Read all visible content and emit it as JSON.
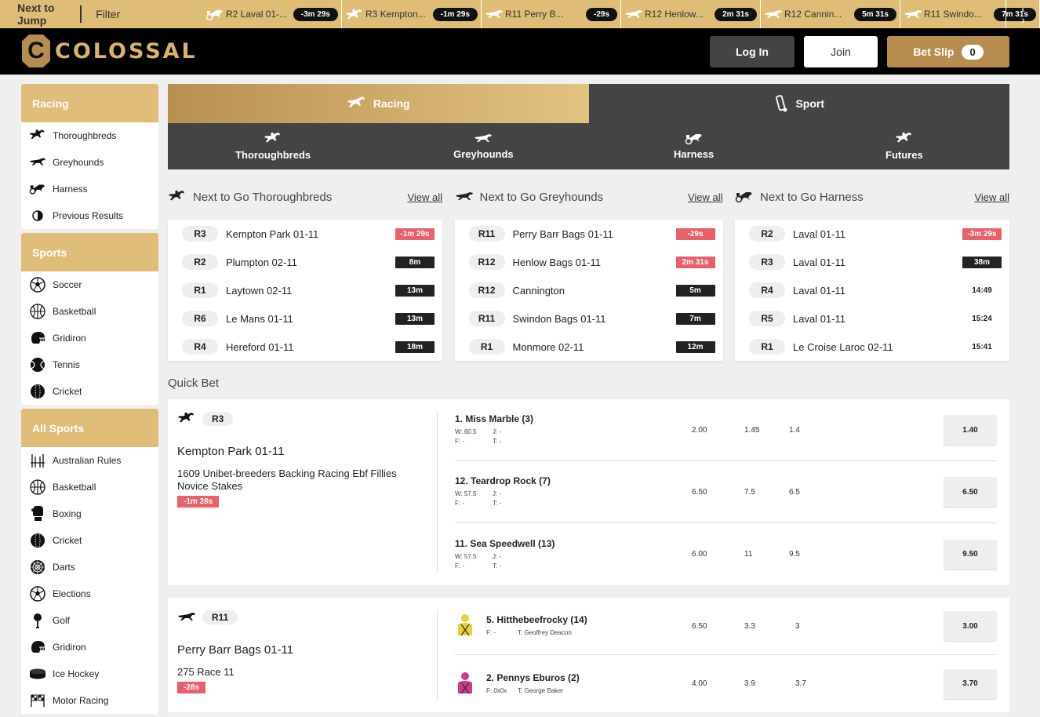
{
  "topbar": {
    "next_to_jump": "Next to Jump",
    "filter": "Filter",
    "items": [
      {
        "name": "R2 Laval 01-...",
        "time": "-3m 29s",
        "icon": "harness-icon"
      },
      {
        "name": "R3 Kempton...",
        "time": "-1m 29s",
        "icon": "horse-icon"
      },
      {
        "name": "R11 Perry B...",
        "time": "-29s",
        "icon": "greyhound-icon"
      },
      {
        "name": "R12 Henlow...",
        "time": "2m 31s",
        "icon": "greyhound-icon"
      },
      {
        "name": "R12 Cannin...",
        "time": "5m 31s",
        "icon": "greyhound-icon"
      },
      {
        "name": "R11 Swindo...",
        "time": "7m 31s",
        "icon": "greyhound-icon"
      }
    ]
  },
  "header": {
    "logo_letter": "C",
    "logo_text": "COLOSSAL",
    "login": "Log In",
    "join": "Join",
    "betslip": "Bet Slip",
    "betslip_count": "0"
  },
  "sidebar": {
    "racing": {
      "title": "Racing",
      "items": [
        {
          "label": "Thoroughbreds",
          "icon": "horse-icon"
        },
        {
          "label": "Greyhounds",
          "icon": "greyhound-icon"
        },
        {
          "label": "Harness",
          "icon": "harness-icon"
        },
        {
          "label": "Previous Results",
          "icon": "results-icon"
        }
      ]
    },
    "sports": {
      "title": "Sports",
      "items": [
        {
          "label": "Soccer",
          "icon": "soccer-ball-icon"
        },
        {
          "label": "Basketball",
          "icon": "basketball-icon"
        },
        {
          "label": "Gridiron",
          "icon": "helmet-icon"
        },
        {
          "label": "Tennis",
          "icon": "tennis-ball-icon"
        },
        {
          "label": "Cricket",
          "icon": "cricket-ball-icon"
        }
      ]
    },
    "all_sports": {
      "title": "All Sports",
      "items": [
        {
          "label": "Australian Rules",
          "icon": "goalposts-icon"
        },
        {
          "label": "Basketball",
          "icon": "basketball-icon"
        },
        {
          "label": "Boxing",
          "icon": "boxing-glove-icon"
        },
        {
          "label": "Cricket",
          "icon": "cricket-ball-icon"
        },
        {
          "label": "Darts",
          "icon": "dartboard-icon"
        },
        {
          "label": "Elections",
          "icon": "soccer-ball-icon"
        },
        {
          "label": "Golf",
          "icon": "golf-icon"
        },
        {
          "label": "Gridiron",
          "icon": "helmet-icon"
        },
        {
          "label": "Ice Hockey",
          "icon": "puck-icon"
        },
        {
          "label": "Motor Racing",
          "icon": "chequered-flag-icon"
        }
      ]
    }
  },
  "main_tabs": {
    "racing": "Racing",
    "sport": "Sport"
  },
  "sub_tabs": [
    "Thoroughbreds",
    "Greyhounds",
    "Harness",
    "Futures"
  ],
  "next_to_go": [
    {
      "title": "Next to Go Thoroughbreds",
      "view_all": "View all",
      "icon": "horse-icon",
      "races": [
        {
          "race": "R3",
          "name": "Kempton Park 01-11",
          "time": "-1m 29s",
          "style": "red"
        },
        {
          "race": "R2",
          "name": "Plumpton 02-11",
          "time": "8m",
          "style": "dark"
        },
        {
          "race": "R1",
          "name": "Laytown 02-11",
          "time": "13m",
          "style": "dark"
        },
        {
          "race": "R6",
          "name": "Le Mans 01-11",
          "time": "13m",
          "style": "dark"
        },
        {
          "race": "R4",
          "name": "Hereford 01-11",
          "time": "18m",
          "style": "dark"
        }
      ]
    },
    {
      "title": "Next to Go Greyhounds",
      "view_all": "View all",
      "icon": "greyhound-icon",
      "races": [
        {
          "race": "R11",
          "name": "Perry Barr Bags 01-11",
          "time": "-29s",
          "style": "red"
        },
        {
          "race": "R12",
          "name": "Henlow Bags 01-11",
          "time": "2m 31s",
          "style": "red"
        },
        {
          "race": "R12",
          "name": "Cannington",
          "time": "5m",
          "style": "dark"
        },
        {
          "race": "R11",
          "name": "Swindon Bags 01-11",
          "time": "7m",
          "style": "dark"
        },
        {
          "race": "R1",
          "name": "Monmore 02-11",
          "time": "12m",
          "style": "dark"
        }
      ]
    },
    {
      "title": "Next to Go Harness",
      "view_all": "View all",
      "icon": "harness-icon",
      "races": [
        {
          "race": "R2",
          "name": "Laval 01-11",
          "time": "-3m 29s",
          "style": "red"
        },
        {
          "race": "R3",
          "name": "Laval 01-11",
          "time": "38m",
          "style": "dark"
        },
        {
          "race": "R4",
          "name": "Laval 01-11",
          "time": "14:49",
          "style": "plain"
        },
        {
          "race": "R5",
          "name": "Laval 01-11",
          "time": "15:24",
          "style": "plain"
        },
        {
          "race": "R1",
          "name": "Le Croise Laroc 02-11",
          "time": "15:41",
          "style": "plain"
        }
      ]
    }
  ],
  "quick_bet": {
    "title": "Quick Bet",
    "cards": [
      {
        "icon": "horse-icon",
        "race": "R3",
        "venue": "Kempton Park 01-11",
        "race_name": "1609 Unibet-breeders Backing Racing Ebf Fillies Novice Stakes",
        "time": "-1m 28s",
        "runners": [
          {
            "name": "1. Miss Marble (3)",
            "w": "W: 60.5",
            "j": "J: -",
            "f": "F: -",
            "t": "T: -",
            "o1": "2.00",
            "o2": "1.45",
            "o3": "1.4",
            "price": "1.40"
          },
          {
            "name": "12. Teardrop Rock (7)",
            "w": "W: 57.5",
            "j": "J: -",
            "f": "F: -",
            "t": "T: -",
            "o1": "6.50",
            "o2": "7.5",
            "o3": "6.5",
            "price": "6.50"
          },
          {
            "name": "11. Sea Speedwell (13)",
            "w": "W: 57.5",
            "j": "J: -",
            "f": "F: -",
            "t": "T: -",
            "o1": "6.00",
            "o2": "11",
            "o3": "9.5",
            "price": "9.50"
          }
        ]
      },
      {
        "icon": "greyhound-icon",
        "race": "R11",
        "venue": "Perry Barr Bags 01-11",
        "race_name": "275 Race 11",
        "time": "-28s",
        "runners": [
          {
            "name": "5. Hitthebeefrocky (14)",
            "f": "F: -",
            "t": "T: Geoffrey Deacon",
            "o1": "6.50",
            "o2": "3.3",
            "o3": "3",
            "price": "3.00",
            "silk": "#e8d23a"
          },
          {
            "name": "2. Pennys Eburos (2)",
            "f": "F: 0x0x",
            "t": "T: George Baker",
            "o1": "4.00",
            "o2": "3.9",
            "o3": "3.7",
            "price": "3.70",
            "silk": "#d3388a"
          }
        ]
      }
    ]
  },
  "colors": {
    "gold": "#dfbc78",
    "dark": "#444444",
    "red": "#e9606a",
    "black": "#000000"
  }
}
